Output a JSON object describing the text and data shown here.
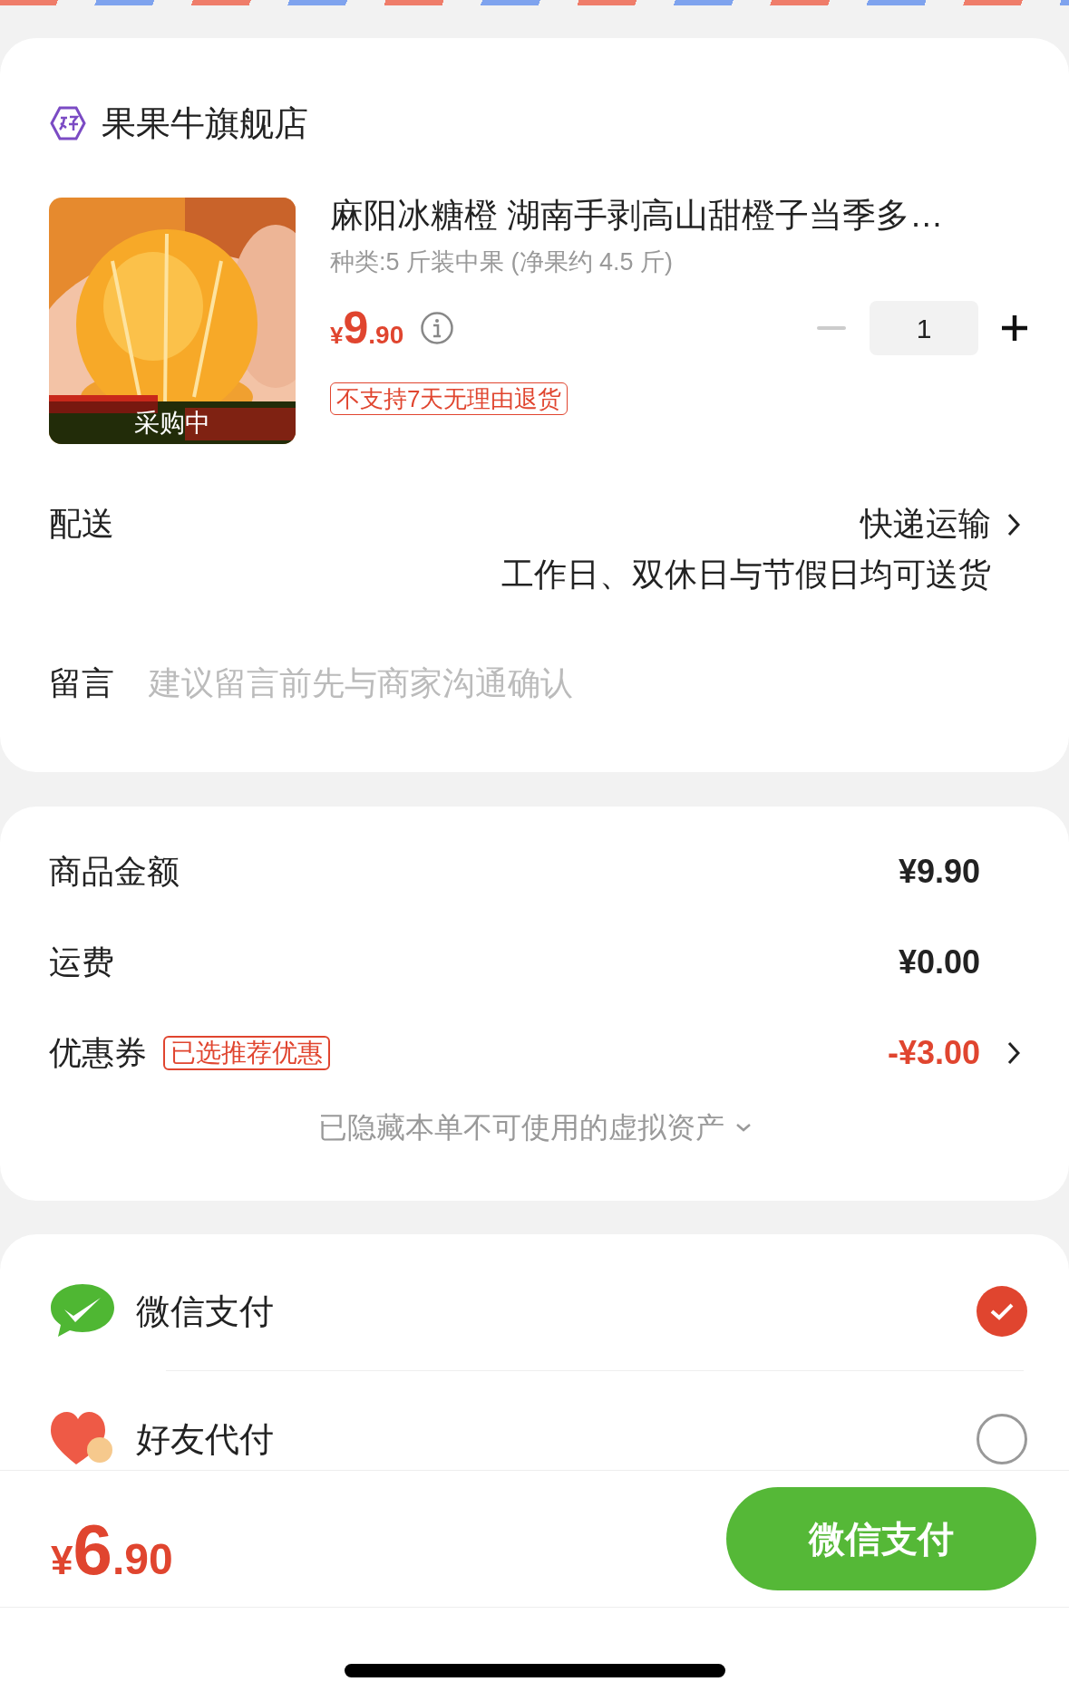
{
  "store": {
    "name": "果果牛旗舰店"
  },
  "product": {
    "image_overlay": "采购中",
    "title": "麻阳冰糖橙 湖南手剥高山甜橙子当季多…",
    "spec": "种类:5 斤装中果 (净果约 4.5 斤)",
    "price": {
      "symbol": "¥",
      "integer": "9",
      "decimal": ".90"
    },
    "quantity": "1",
    "tag": "不支持7天无理由退货"
  },
  "delivery": {
    "label": "配送",
    "method": "快递运输",
    "note": "工作日、双休日与节假日均可送货"
  },
  "message": {
    "label": "留言",
    "placeholder": "建议留言前先与商家沟通确认"
  },
  "summary": {
    "rows": [
      {
        "kind": "plain",
        "label": "商品金额",
        "value": "¥9.90"
      },
      {
        "kind": "plain",
        "label": "运费",
        "value": "¥0.00"
      },
      {
        "kind": "discount",
        "label": "优惠券",
        "badge": "已选推荐优惠",
        "value": "-¥3.00"
      }
    ],
    "hidden_note": "已隐藏本单不可使用的虚拟资产"
  },
  "payment_methods": [
    {
      "kind": "wechat",
      "name": "微信支付",
      "selected": true
    },
    {
      "kind": "friend",
      "name": "好友代付",
      "selected": false
    }
  ],
  "footer": {
    "price": {
      "symbol": "¥",
      "integer": "6",
      "decimal": ".90"
    },
    "button": "微信支付"
  }
}
